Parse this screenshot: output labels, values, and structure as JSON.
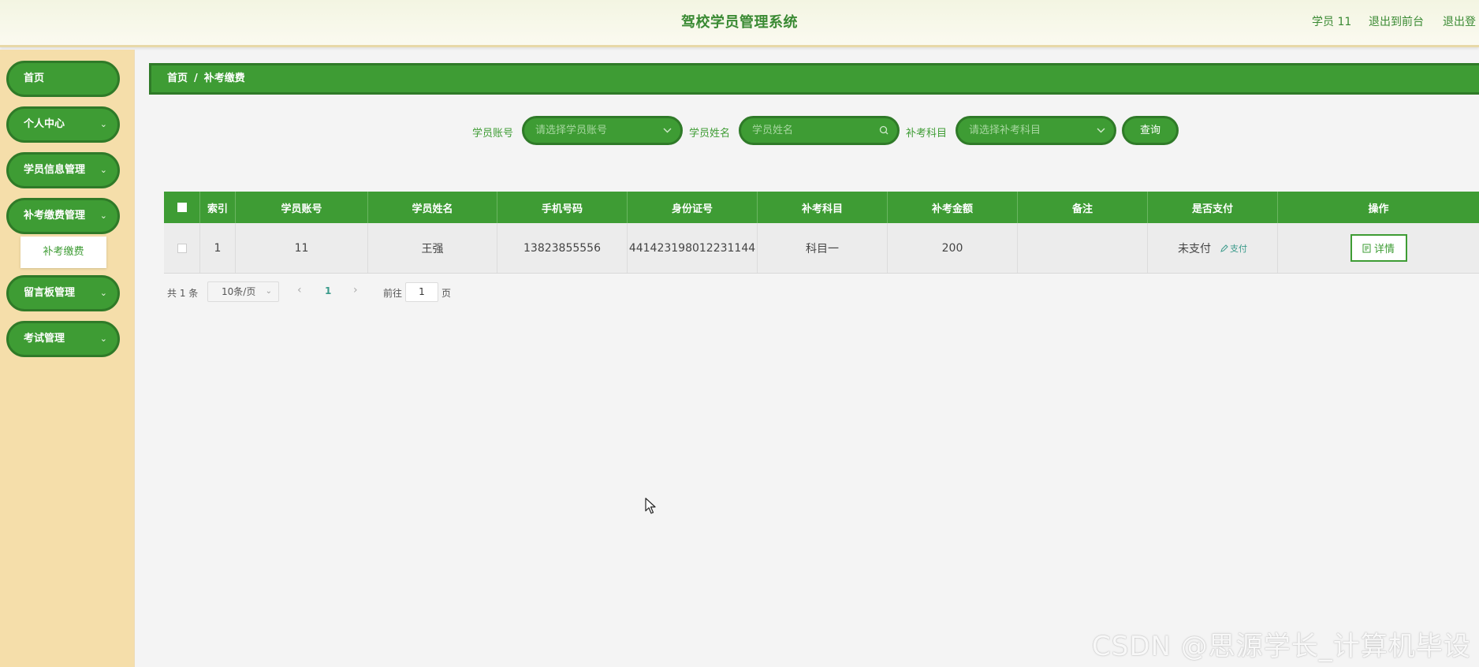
{
  "header": {
    "title": "驾校学员管理系统",
    "user_label": "学员 11",
    "to_front": "退出到前台",
    "logout": "退出登"
  },
  "sidebar": {
    "items": [
      {
        "label": "首页",
        "chevron": ""
      },
      {
        "label": "个人中心",
        "chevron": "⌄"
      },
      {
        "label": "学员信息管理",
        "chevron": "⌄"
      },
      {
        "label": "补考缴费管理",
        "chevron": "⌄"
      },
      {
        "label": "留言板管理",
        "chevron": "⌄"
      },
      {
        "label": "考试管理",
        "chevron": "⌄"
      }
    ],
    "subitem": "补考缴费"
  },
  "breadcrumb": {
    "home": "首页",
    "separator": "/",
    "current": "补考缴费"
  },
  "search": {
    "account_label": "学员账号",
    "account_placeholder": "请选择学员账号",
    "name_label": "学员姓名",
    "name_placeholder": "学员姓名",
    "subject_label": "补考科目",
    "subject_placeholder": "请选择补考科目",
    "query_button": "查询"
  },
  "table": {
    "columns": [
      "索引",
      "学员账号",
      "学员姓名",
      "手机号码",
      "身份证号",
      "补考科目",
      "补考金额",
      "备注",
      "是否支付",
      "操作"
    ],
    "rows": [
      {
        "index": "1",
        "account": "11",
        "name": "王强",
        "phone": "13823855556",
        "id_card": "441423198012231144",
        "subject": "科目一",
        "amount": "200",
        "remark": "",
        "paid": "未支付",
        "pay_link": "支付",
        "detail_button": "详情"
      }
    ]
  },
  "pagination": {
    "total": "共 1 条",
    "page_size": "10条/页",
    "current_page": "1",
    "goto_label": "前往",
    "goto_value": "1",
    "page_suffix": "页"
  },
  "watermark": "CSDN @思源学长_计算机毕设",
  "colors": {
    "primary_green": "#3e9c34",
    "dark_green": "#2f7a28",
    "sidebar_bg": "#f5deaa",
    "header_bg": "#f3f5e2",
    "page_bg": "#f4f4f4"
  },
  "icons": {
    "select_chevron": "chevron-down-icon",
    "search": "search-icon",
    "edit": "edit-icon",
    "document": "document-icon"
  }
}
